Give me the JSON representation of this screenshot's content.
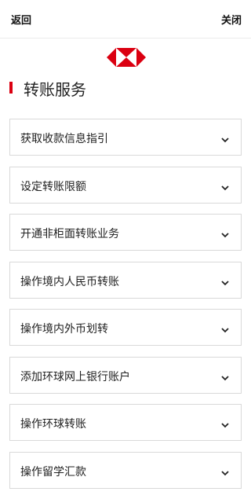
{
  "header": {
    "back_label": "返回",
    "close_label": "关闭"
  },
  "brand": {
    "logo_icon": "hsbc-hexagon-logo",
    "accent_color": "#db0011"
  },
  "page": {
    "title": "转账服务"
  },
  "menu": {
    "items": [
      {
        "label": "获取收款信息指引",
        "icon": "chevron-down-icon"
      },
      {
        "label": "设定转账限额",
        "icon": "chevron-down-icon"
      },
      {
        "label": "开通非柜面转账业务",
        "icon": "chevron-down-icon"
      },
      {
        "label": "操作境内人民币转账",
        "icon": "chevron-down-icon"
      },
      {
        "label": "操作境内外币划转",
        "icon": "chevron-down-icon"
      },
      {
        "label": "添加环球网上银行账户",
        "icon": "chevron-down-icon"
      },
      {
        "label": "操作环球转账",
        "icon": "chevron-down-icon"
      },
      {
        "label": "操作留学汇款",
        "icon": "chevron-down-icon"
      }
    ]
  }
}
